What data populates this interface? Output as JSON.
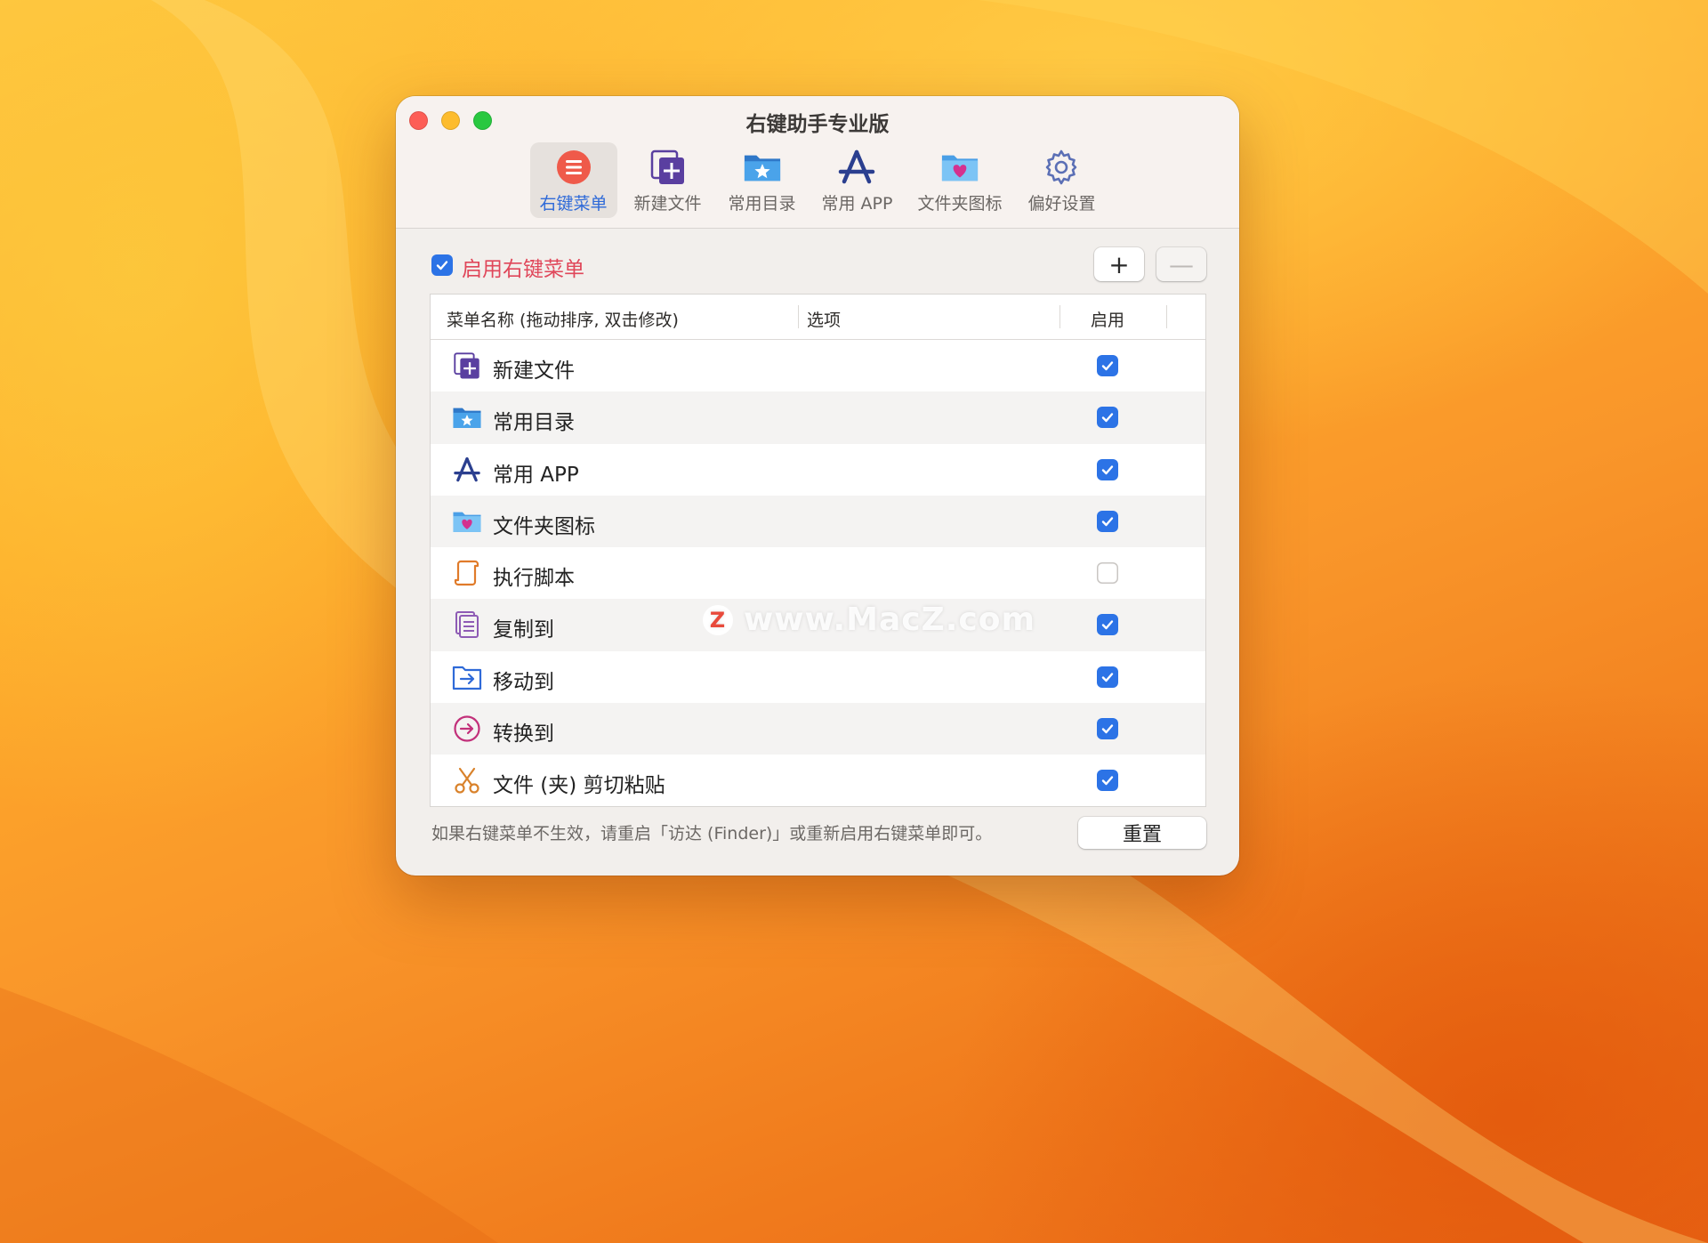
{
  "window": {
    "title": "右键助手专业版"
  },
  "toolbar": {
    "tabs": [
      {
        "label": "右键菜单",
        "icon": "menu-icon",
        "active": true
      },
      {
        "label": "新建文件",
        "icon": "new-file-icon",
        "active": false
      },
      {
        "label": "常用目录",
        "icon": "folder-star-icon",
        "active": false
      },
      {
        "label": "常用 APP",
        "icon": "app-store-icon",
        "active": false
      },
      {
        "label": "文件夹图标",
        "icon": "folder-heart-icon",
        "active": false
      },
      {
        "label": "偏好设置",
        "icon": "gear-icon",
        "active": false
      }
    ]
  },
  "main": {
    "enable_label": "启用右键菜单",
    "enable_checked": true,
    "add_label": "+",
    "remove_label": "—",
    "columns": {
      "name": "菜单名称 (拖动排序, 双击修改)",
      "options": "选项",
      "enabled": "启用"
    },
    "rows": [
      {
        "name": "新建文件",
        "icon": "new-file-icon",
        "enabled": true
      },
      {
        "name": "常用目录",
        "icon": "folder-star-icon",
        "enabled": true
      },
      {
        "name": "常用 APP",
        "icon": "app-store-icon",
        "enabled": true
      },
      {
        "name": "文件夹图标",
        "icon": "folder-heart-icon",
        "enabled": true
      },
      {
        "name": "执行脚本",
        "icon": "script-icon",
        "enabled": false
      },
      {
        "name": "复制到",
        "icon": "copy-icon",
        "enabled": true
      },
      {
        "name": "移动到",
        "icon": "move-folder-icon",
        "enabled": true
      },
      {
        "name": "转换到",
        "icon": "convert-icon",
        "enabled": true
      },
      {
        "name": "文件 (夹) 剪切粘贴",
        "icon": "scissors-icon",
        "enabled": true
      }
    ],
    "footer_note": "如果右键菜单不生效，请重启「访达 (Finder)」或重新启用右键菜单即可。",
    "reset_label": "重置"
  },
  "watermark": {
    "badge": "Z",
    "text": "www.MacZ.com"
  },
  "colors": {
    "accent": "#2c73e6",
    "enable_label": "#e0475a",
    "menu_icon": "#ef5a4a",
    "new_file_icon": "#5a3fa0",
    "folder_icon": "#3b8fe0",
    "folder_heart": "#d4318f",
    "script_icon": "#e07b2a",
    "copy_icon": "#8e5bb5",
    "move_icon": "#2f6ad8",
    "convert_icon": "#c2307a",
    "scissors_icon": "#d9822b"
  }
}
